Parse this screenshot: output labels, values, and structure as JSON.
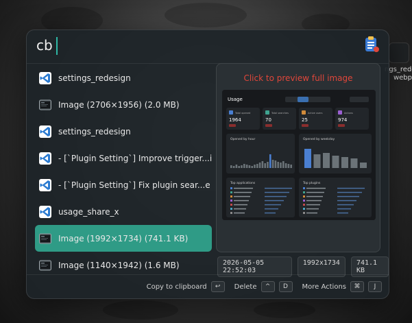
{
  "search": {
    "query": "cb"
  },
  "results": [
    {
      "icon": "vscode-icon",
      "label": "settings_redesign"
    },
    {
      "icon": "image-icon",
      "label": "Image (2706×1956) (2.0 MB)"
    },
    {
      "icon": "vscode-icon",
      "label": "settings_redesign"
    },
    {
      "icon": "vscode-icon",
      "label": "- [`Plugin Setting`] Improve trigger...itc..."
    },
    {
      "icon": "vscode-icon",
      "label": "- [`Plugin Setting`] Fix plugin sear...e is ..."
    },
    {
      "icon": "vscode-icon",
      "label": "usage_share_x"
    },
    {
      "icon": "image-icon",
      "label": "Image (1992×1734) (741.1 KB)",
      "selected": true
    },
    {
      "icon": "image-icon",
      "label": "Image (1140×1942) (1.6 MB)"
    }
  ],
  "preview": {
    "title": "Click to preview full image",
    "thumb": {
      "heading": "Usage",
      "stats": [
        {
          "label": "Total opened",
          "value": "1964"
        },
        {
          "label": "Total searches",
          "value": "70"
        },
        {
          "label": "Active users",
          "value": "25"
        },
        {
          "label": "Actions",
          "value": "974"
        }
      ],
      "panel_left": "Opened by hour",
      "panel_right": "Opened by weekday",
      "list_left": "Top applications",
      "list_right": "Top plugins"
    }
  },
  "meta": {
    "date": "2026-05-05 22:52:03",
    "dimensions": "1992x1734",
    "size": "741.1 KB"
  },
  "footer": {
    "copy_label": "Copy to clipboard",
    "copy_key": "↩",
    "delete_label": "Delete",
    "delete_key1": "^",
    "delete_key2": "D",
    "more_label": "More Actions",
    "more_key1": "⌘",
    "more_key2": "J"
  },
  "side": {
    "text1": "ngs_redes",
    "text2": "webp"
  },
  "colors": {
    "accent": "#2f9b86",
    "preview_title": "#e0463a",
    "vscode_blue": "#2b7bd1"
  }
}
